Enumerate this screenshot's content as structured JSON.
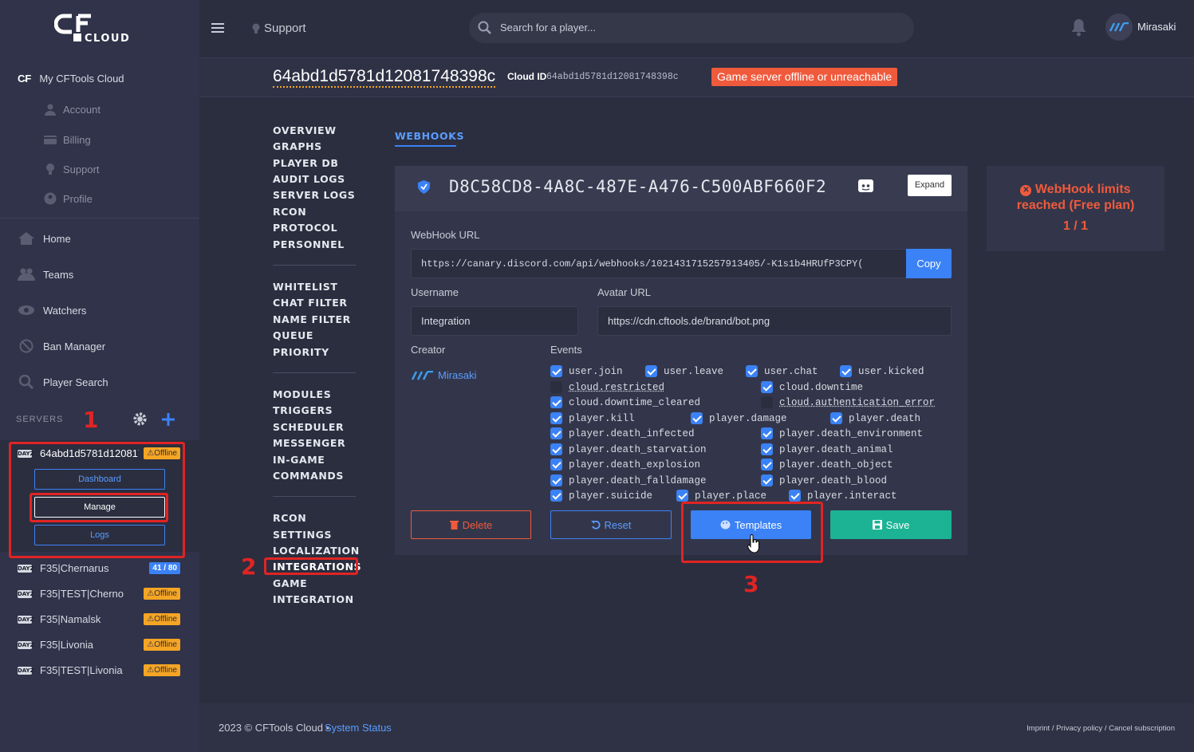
{
  "brand": {
    "logo_top": "CF",
    "logo_bottom": "CLOUD"
  },
  "sidebar": {
    "my_cloud": "My CFTools Cloud",
    "sub_items": [
      {
        "label": "Account",
        "icon": "user-icon"
      },
      {
        "label": "Billing",
        "icon": "card-icon"
      },
      {
        "label": "Support",
        "icon": "lightbulb-icon"
      },
      {
        "label": "Profile",
        "icon": "profile-icon"
      }
    ],
    "main_items": [
      {
        "label": "Home",
        "icon": "home-icon"
      },
      {
        "label": "Teams",
        "icon": "users-icon"
      },
      {
        "label": "Watchers",
        "icon": "eye-icon"
      },
      {
        "label": "Ban Manager",
        "icon": "ban-icon"
      },
      {
        "label": "Player Search",
        "icon": "search-icon"
      }
    ],
    "servers_label": "SERVERS",
    "active_server": {
      "name": "64abd1d5781d12081748398c",
      "status": "Offline",
      "buttons": {
        "dashboard": "Dashboard",
        "manage": "Manage",
        "logs": "Logs"
      }
    },
    "servers": [
      {
        "name": "F35|Chernarus",
        "badge": "41 / 80",
        "type": "count"
      },
      {
        "name": "F35|TEST|Cherno",
        "badge": "Offline",
        "type": "offline"
      },
      {
        "name": "F35|Namalsk",
        "badge": "Offline",
        "type": "offline"
      },
      {
        "name": "F35|Livonia",
        "badge": "Offline",
        "type": "offline"
      },
      {
        "name": "F35|TEST|Livonia",
        "badge": "Offline",
        "type": "offline"
      }
    ],
    "game_tag": "DAYZ"
  },
  "topbar": {
    "support": "Support",
    "search_placeholder": "Search for a player...",
    "user": "Mirasaki"
  },
  "header": {
    "server_id": "64abd1d5781d12081748398c",
    "cloud_id_label": "Cloud ID",
    "cloud_id": "64abd1d5781d12081748398c",
    "status_alert": "Game server offline or unreachable"
  },
  "nav": {
    "group1": [
      "OVERVIEW",
      "GRAPHS",
      "PLAYER DB",
      "AUDIT LOGS",
      "SERVER LOGS",
      "RCON",
      "PROTOCOL",
      "PERSONNEL"
    ],
    "group2": [
      "WHITELIST",
      "CHAT FILTER",
      "NAME FILTER",
      "QUEUE",
      "PRIORITY"
    ],
    "group3": [
      "MODULES",
      "TRIGGERS",
      "SCHEDULER",
      "MESSENGER",
      "IN-GAME",
      "COMMANDS"
    ],
    "group4": [
      "RCON",
      "SETTINGS",
      "LOCALIZATION",
      "INTEGRATIONS",
      "GAME",
      "INTEGRATION"
    ]
  },
  "webhooks": {
    "tab": "WEBHOOKS",
    "id": "D8C58CD8-4A8C-487E-A476-C500ABF660F2",
    "expand": "Expand",
    "url_label": "WebHook URL",
    "url": "https://canary.discord.com/api/webhooks/1021431715257913405/-K1s1b4HRUfP3CPY(",
    "copy": "Copy",
    "username_label": "Username",
    "username": "Integration",
    "avatar_label": "Avatar URL",
    "avatar": "https://cdn.cftools.de/brand/bot.png",
    "creator_label": "Creator",
    "creator": "Mirasaki",
    "events_label": "Events",
    "events": [
      {
        "label": "user.join",
        "checked": true
      },
      {
        "label": "user.leave",
        "checked": true
      },
      {
        "label": "user.chat",
        "checked": true
      },
      {
        "label": "user.kicked",
        "checked": true
      },
      {
        "label": "cloud.restricted",
        "checked": false
      },
      {
        "label": "cloud.downtime",
        "checked": true
      },
      {
        "label": "cloud.downtime_cleared",
        "checked": true
      },
      {
        "label": "cloud.authentication_error",
        "checked": false
      },
      {
        "label": "player.kill",
        "checked": true
      },
      {
        "label": "player.damage",
        "checked": true
      },
      {
        "label": "player.death",
        "checked": true
      },
      {
        "label": "player.death_infected",
        "checked": true
      },
      {
        "label": "player.death_environment",
        "checked": true
      },
      {
        "label": "player.death_starvation",
        "checked": true
      },
      {
        "label": "player.death_animal",
        "checked": true
      },
      {
        "label": "player.death_explosion",
        "checked": true
      },
      {
        "label": "player.death_object",
        "checked": true
      },
      {
        "label": "player.death_falldamage",
        "checked": true
      },
      {
        "label": "player.death_blood",
        "checked": true
      },
      {
        "label": "player.suicide",
        "checked": true
      },
      {
        "label": "player.place",
        "checked": true
      },
      {
        "label": "player.interact",
        "checked": true
      }
    ],
    "buttons": {
      "delete": "Delete",
      "reset": "Reset",
      "templates": "Templates",
      "save": "Save"
    }
  },
  "limit": {
    "title": "WebHook limits reached (Free plan)",
    "count": "1 / 1"
  },
  "annotations": [
    "1",
    "2",
    "3"
  ],
  "footer": {
    "copyright": "2023 © CFTools Cloud •",
    "status_link": "System Status",
    "links": "Imprint / Privacy policy / Cancel subscription"
  },
  "colors": {
    "accent": "#3b82f6",
    "danger": "#f05a3c",
    "success": "#1bb394",
    "warning": "#f5a524",
    "annotation": "#e02424"
  }
}
